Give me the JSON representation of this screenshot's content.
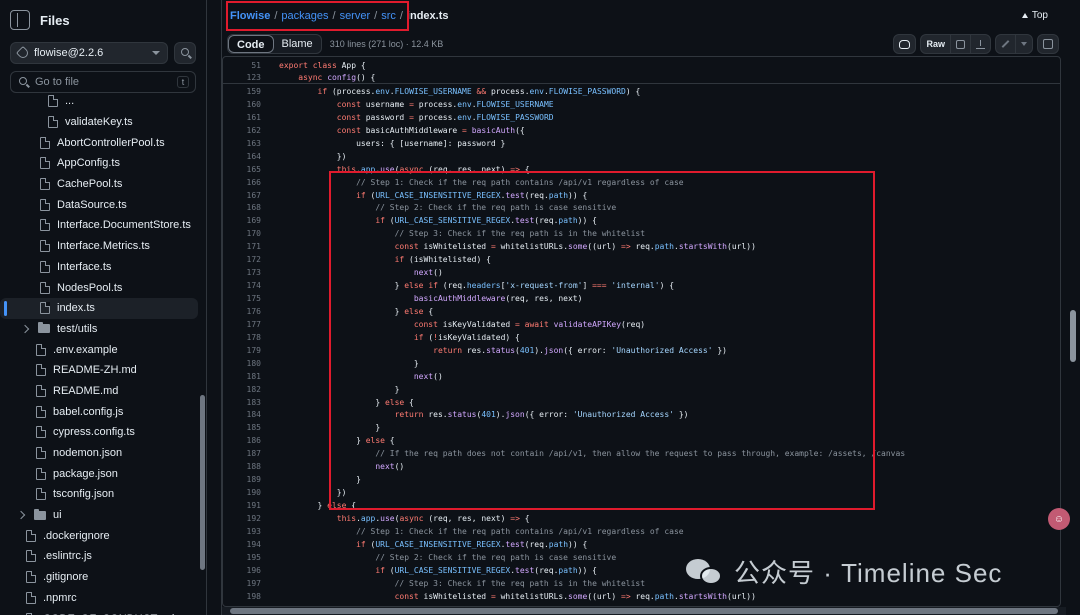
{
  "sidebar": {
    "title": "Files",
    "branch": "flowise@2.2.6",
    "goto_placeholder": "Go to file",
    "goto_key": "t",
    "items": [
      {
        "label": "...",
        "type": "file",
        "indent": 48
      },
      {
        "label": "validateKey.ts",
        "type": "file",
        "indent": 48
      },
      {
        "label": "AbortControllerPool.ts",
        "type": "file",
        "indent": 40
      },
      {
        "label": "AppConfig.ts",
        "type": "file",
        "indent": 40
      },
      {
        "label": "CachePool.ts",
        "type": "file",
        "indent": 40
      },
      {
        "label": "DataSource.ts",
        "type": "file",
        "indent": 40
      },
      {
        "label": "Interface.DocumentStore.ts",
        "type": "file",
        "indent": 40
      },
      {
        "label": "Interface.Metrics.ts",
        "type": "file",
        "indent": 40
      },
      {
        "label": "Interface.ts",
        "type": "file",
        "indent": 40
      },
      {
        "label": "NodesPool.ts",
        "type": "file",
        "indent": 40
      },
      {
        "label": "index.ts",
        "type": "file",
        "indent": 40,
        "active": true
      },
      {
        "label": "test/utils",
        "type": "folder",
        "indent": 22
      },
      {
        "label": ".env.example",
        "type": "file",
        "indent": 36
      },
      {
        "label": "README-ZH.md",
        "type": "file",
        "indent": 36
      },
      {
        "label": "README.md",
        "type": "file",
        "indent": 36
      },
      {
        "label": "babel.config.js",
        "type": "file",
        "indent": 36
      },
      {
        "label": "cypress.config.ts",
        "type": "file",
        "indent": 36
      },
      {
        "label": "nodemon.json",
        "type": "file",
        "indent": 36
      },
      {
        "label": "package.json",
        "type": "file",
        "indent": 36
      },
      {
        "label": "tsconfig.json",
        "type": "file",
        "indent": 36
      },
      {
        "label": "ui",
        "type": "folder",
        "indent": 18
      },
      {
        "label": ".dockerignore",
        "type": "file",
        "indent": 26
      },
      {
        "label": ".eslintrc.js",
        "type": "file",
        "indent": 26
      },
      {
        "label": ".gitignore",
        "type": "file",
        "indent": 26
      },
      {
        "label": ".npmrc",
        "type": "file",
        "indent": 26
      },
      {
        "label": "CODE_OF_CONDUCT.md",
        "type": "file",
        "indent": 26
      }
    ]
  },
  "breadcrumb": {
    "parts": [
      "Flowise",
      "packages",
      "server",
      "src"
    ],
    "separator": "/",
    "current": "index.ts"
  },
  "top_label": "Top",
  "toolbar": {
    "code_tab": "Code",
    "blame_tab": "Blame",
    "meta": "310 lines (271 loc) · 12.4 KB",
    "raw_label": "Raw"
  },
  "sticky_lines": [
    {
      "n": "51",
      "html": "<span class=\"k\">export class</span> App {"
    },
    {
      "n": "123",
      "html": "    <span class=\"k\">async</span> <span class=\"f\">config</span>() {"
    }
  ],
  "code_lines": [
    {
      "n": "159",
      "html": "        <span class=\"k\">if</span> (process.<span class=\"n\">env</span>.<span class=\"n\">FLOWISE_USERNAME</span> <span class=\"k\">&amp;&amp;</span> process.<span class=\"n\">env</span>.<span class=\"n\">FLOWISE_PASSWORD</span>) {"
    },
    {
      "n": "160",
      "html": "            <span class=\"k\">const</span> username <span class=\"k\">=</span> process.<span class=\"n\">env</span>.<span class=\"n\">FLOWISE_USERNAME</span>"
    },
    {
      "n": "161",
      "html": "            <span class=\"k\">const</span> password <span class=\"k\">=</span> process.<span class=\"n\">env</span>.<span class=\"n\">FLOWISE_PASSWORD</span>"
    },
    {
      "n": "162",
      "html": "            <span class=\"k\">const</span> basicAuthMiddleware <span class=\"k\">=</span> <span class=\"f\">basicAuth</span>({"
    },
    {
      "n": "163",
      "html": "                users: { [username]: password }"
    },
    {
      "n": "164",
      "html": "            })"
    },
    {
      "n": "165",
      "html": "            <span class=\"k\">this</span>.<span class=\"n\">app</span>.<span class=\"f\">use</span>(<span class=\"k\">async</span> (req, res, next) <span class=\"k\">=&gt;</span> {"
    },
    {
      "n": "166",
      "html": "                <span class=\"c\">// Step 1: Check if the req path contains /api/v1 regardless of case</span>"
    },
    {
      "n": "167",
      "html": "                <span class=\"k\">if</span> (<span class=\"n\">URL_CASE_INSENSITIVE_REGEX</span>.<span class=\"f\">test</span>(req.<span class=\"n\">path</span>)) {"
    },
    {
      "n": "168",
      "html": "                    <span class=\"c\">// Step 2: Check if the req path is case sensitive</span>"
    },
    {
      "n": "169",
      "html": "                    <span class=\"k\">if</span> (<span class=\"n\">URL_CASE_SENSITIVE_REGEX</span>.<span class=\"f\">test</span>(req.<span class=\"n\">path</span>)) {"
    },
    {
      "n": "170",
      "html": "                        <span class=\"c\">// Step 3: Check if the req path is in the whitelist</span>"
    },
    {
      "n": "171",
      "html": "                        <span class=\"k\">const</span> isWhitelisted <span class=\"k\">=</span> whitelistURLs.<span class=\"f\">some</span>((url) <span class=\"k\">=&gt;</span> req.<span class=\"n\">path</span>.<span class=\"f\">startsWith</span>(url))"
    },
    {
      "n": "172",
      "html": "                        <span class=\"k\">if</span> (isWhitelisted) {"
    },
    {
      "n": "173",
      "html": "                            <span class=\"f\">next</span>()"
    },
    {
      "n": "174",
      "html": "                        } <span class=\"k\">else if</span> (req.<span class=\"n\">headers</span>[<span class=\"s\">'x-request-from'</span>] <span class=\"k\">===</span> <span class=\"s\">'internal'</span>) {"
    },
    {
      "n": "175",
      "html": "                            <span class=\"f\">basicAuthMiddleware</span>(req, res, next)"
    },
    {
      "n": "176",
      "html": "                        } <span class=\"k\">else</span> {"
    },
    {
      "n": "177",
      "html": "                            <span class=\"k\">const</span> isKeyValidated <span class=\"k\">=</span> <span class=\"k\">await</span> <span class=\"f\">validateAPIKey</span>(req)"
    },
    {
      "n": "178",
      "html": "                            <span class=\"k\">if</span> (<span class=\"k\">!</span>isKeyValidated) {"
    },
    {
      "n": "179",
      "html": "                                <span class=\"k\">return</span> res.<span class=\"f\">status</span>(<span class=\"n\">401</span>).<span class=\"f\">json</span>({ error: <span class=\"s\">'Unauthorized Access'</span> })"
    },
    {
      "n": "180",
      "html": "                            }"
    },
    {
      "n": "181",
      "html": "                            <span class=\"f\">next</span>()"
    },
    {
      "n": "182",
      "html": "                        }"
    },
    {
      "n": "183",
      "html": "                    } <span class=\"k\">else</span> {"
    },
    {
      "n": "184",
      "html": "                        <span class=\"k\">return</span> res.<span class=\"f\">status</span>(<span class=\"n\">401</span>).<span class=\"f\">json</span>({ error: <span class=\"s\">'Unauthorized Access'</span> })"
    },
    {
      "n": "185",
      "html": "                    }"
    },
    {
      "n": "186",
      "html": "                } <span class=\"k\">else</span> {"
    },
    {
      "n": "187",
      "html": "                    <span class=\"c\">// If the req path does not contain /api/v1, then allow the request to pass through, example: /assets, /canvas</span>"
    },
    {
      "n": "188",
      "html": "                    <span class=\"f\">next</span>()"
    },
    {
      "n": "189",
      "html": "                }"
    },
    {
      "n": "190",
      "html": "            })"
    },
    {
      "n": "191",
      "html": "        } <span class=\"k\">else</span> {"
    },
    {
      "n": "192",
      "html": "            <span class=\"k\">this</span>.<span class=\"n\">app</span>.<span class=\"f\">use</span>(<span class=\"k\">async</span> (req, res, next) <span class=\"k\">=&gt;</span> {"
    },
    {
      "n": "193",
      "html": "                <span class=\"c\">// Step 1: Check if the req path contains /api/v1 regardless of case</span>"
    },
    {
      "n": "194",
      "html": "                <span class=\"k\">if</span> (<span class=\"n\">URL_CASE_INSENSITIVE_REGEX</span>.<span class=\"f\">test</span>(req.<span class=\"n\">path</span>)) {"
    },
    {
      "n": "195",
      "html": "                    <span class=\"c\">// Step 2: Check if the req path is case sensitive</span>"
    },
    {
      "n": "196",
      "html": "                    <span class=\"k\">if</span> (<span class=\"n\">URL_CASE_SENSITIVE_REGEX</span>.<span class=\"f\">test</span>(req.<span class=\"n\">path</span>)) {"
    },
    {
      "n": "197",
      "html": "                        <span class=\"c\">// Step 3: Check if the req path is in the whitelist</span>"
    },
    {
      "n": "198",
      "html": "                        <span class=\"k\">const</span> isWhitelisted <span class=\"k\">=</span> whitelistURLs.<span class=\"f\">some</span>((url) <span class=\"k\">=&gt;</span> req.<span class=\"n\">path</span>.<span class=\"f\">startsWith</span>(url))"
    }
  ],
  "watermark": {
    "text": "公众号 · Timeline Sec"
  },
  "badge_text": "☺",
  "colors": {
    "background": "#0d1117",
    "link": "#4493f8",
    "highlight_box": "#e01b2d"
  }
}
